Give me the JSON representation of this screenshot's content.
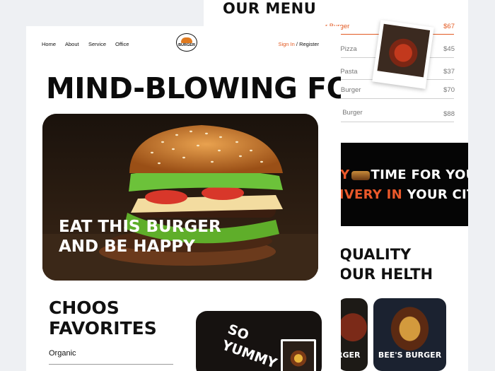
{
  "menu": {
    "title": "OUR MENU",
    "items": [
      {
        "name": "r Burger",
        "price": "$67",
        "highlight": true
      },
      {
        "name": "y Pizza",
        "price": "$45",
        "highlight": false
      },
      {
        "name": "en Pasta",
        "price": "$37",
        "highlight": false
      },
      {
        "name": "d Burger",
        "price": "$70",
        "highlight": false
      },
      {
        "name": "en Burger",
        "price": "$88",
        "highlight": false
      }
    ]
  },
  "delivery_banner": {
    "line1_orange": "RY",
    "line1_white": "TIME FOR YOU",
    "line2_orange": "LIVERY IN",
    "line2_white": " YOUR CITY"
  },
  "quality": {
    "line1": "QUALITY",
    "line2": "OUR HELTH"
  },
  "cards": [
    {
      "label": "RGER"
    },
    {
      "label": "BEE'S BURGER"
    }
  ],
  "nav": {
    "items": [
      "Home",
      "About",
      "Service",
      "Office"
    ],
    "logo_text": "BURGER",
    "sign_in": "Sign In",
    "separator": " / ",
    "register": "Register"
  },
  "hero": {
    "headline": "MIND-BLOWING FOOD",
    "text_line1": "EAT THIS BURGER",
    "text_line2": "AND BE HAPPY"
  },
  "favorites": {
    "title_line1": "CHOOS",
    "title_line2": "FAVORITES",
    "first_item": "Organic"
  },
  "yummy": {
    "line1": "SO",
    "line2": "YUMMY"
  },
  "colors": {
    "accent": "#e35a22",
    "dark": "#0b0b0b",
    "background": "#eef0f3"
  }
}
